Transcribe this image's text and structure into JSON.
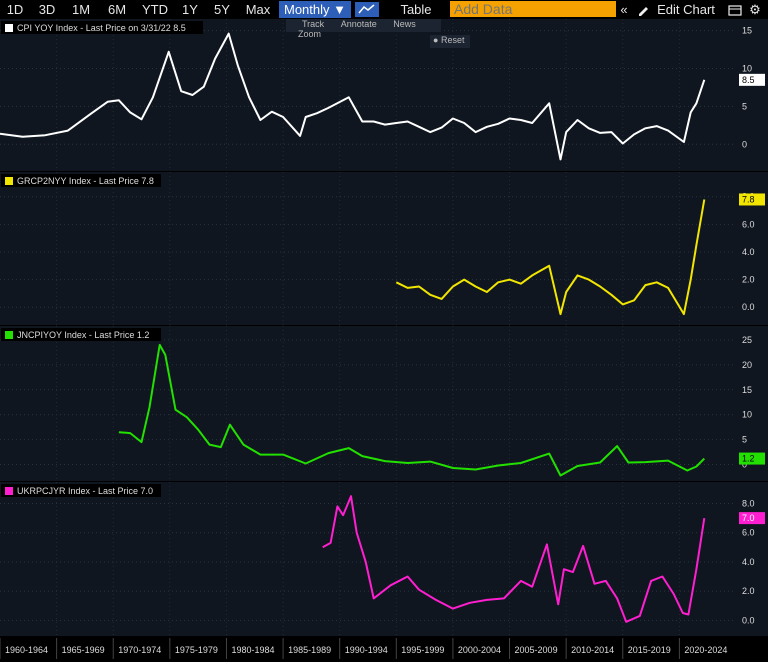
{
  "toolbar": {
    "periods": [
      "1D",
      "3D",
      "1M",
      "6M",
      "YTD",
      "1Y",
      "5Y",
      "Max"
    ],
    "frequency": "Monthly ▼",
    "table_label": "Table",
    "add_data_placeholder": "Add Data",
    "edit_chart_label": "Edit Chart",
    "tools": {
      "track": "Track",
      "annotate": "Annotate",
      "news": "News",
      "zoom": "Zoom",
      "reset": "Reset"
    }
  },
  "colors": {
    "background": "#000000",
    "panel_bg": "#0f1620",
    "cpi": "#ffffff",
    "grc": "#f2e600",
    "jn": "#22e000",
    "uk": "#ff1fd0",
    "active_button": "#2e5fb8",
    "add_data": "#f5a200"
  },
  "chart_data": [
    {
      "type": "line",
      "legend": "CPI YOY Index - Last Price on 3/31/22 8.5",
      "last_value_label": "8.5",
      "ylim": [
        -3,
        16
      ],
      "yticks": [
        "15",
        "10",
        "5",
        "0"
      ],
      "ytick_values": [
        15,
        10,
        5,
        0
      ],
      "x": [
        1960,
        1962,
        1964,
        1966,
        1968,
        1969.5,
        1970.5,
        1971.5,
        1972.5,
        1973.5,
        1974.9,
        1976,
        1977,
        1978,
        1979,
        1980.2,
        1981,
        1982,
        1983,
        1984,
        1985,
        1986.5,
        1987,
        1988,
        1989,
        1990.8,
        1992,
        1993,
        1994,
        1995,
        1996,
        1997,
        1998,
        1999,
        2000,
        2001,
        2002,
        2003,
        2004,
        2005,
        2006,
        2007,
        2008.5,
        2009.5,
        2010,
        2011,
        2012,
        2013,
        2014,
        2015,
        2016,
        2017,
        2018,
        2019,
        2020.4,
        2021,
        2021.5,
        2022.2
      ],
      "y": [
        1.4,
        1.0,
        1.2,
        1.8,
        4.0,
        5.6,
        5.8,
        4.2,
        3.3,
        6.2,
        12.2,
        7.0,
        6.5,
        7.6,
        11.3,
        14.6,
        10.4,
        6.2,
        3.2,
        4.3,
        3.6,
        1.1,
        3.6,
        4.1,
        4.8,
        6.2,
        3.0,
        3.0,
        2.6,
        2.8,
        3.0,
        2.3,
        1.6,
        2.2,
        3.4,
        2.8,
        1.6,
        2.3,
        2.7,
        3.4,
        3.2,
        2.8,
        5.4,
        -2.0,
        1.6,
        3.2,
        2.1,
        1.5,
        1.6,
        0.1,
        1.3,
        2.1,
        2.4,
        1.8,
        0.3,
        4.2,
        5.4,
        8.5
      ]
    },
    {
      "type": "line",
      "legend": "GRCP2NYY Index - Last Price 7.8",
      "last_value_label": "7.8",
      "ylim": [
        -1,
        9.5
      ],
      "yticks": [
        "8.0",
        "6.0",
        "4.0",
        "2.0",
        "0.0"
      ],
      "ytick_values": [
        8,
        6,
        4,
        2,
        0
      ],
      "x": [
        1995,
        1996,
        1997,
        1998,
        1999,
        2000,
        2001,
        2002,
        2003,
        2004,
        2005,
        2006,
        2007,
        2008.5,
        2009.5,
        2010,
        2011,
        2012,
        2013,
        2014,
        2015,
        2016,
        2017,
        2018,
        2019,
        2020.4,
        2021,
        2021.5,
        2022.2
      ],
      "y": [
        1.8,
        1.4,
        1.5,
        0.9,
        0.6,
        1.5,
        2.0,
        1.5,
        1.1,
        1.8,
        2.0,
        1.7,
        2.3,
        3.0,
        -0.5,
        1.1,
        2.3,
        2.0,
        1.5,
        0.9,
        0.2,
        0.5,
        1.6,
        1.8,
        1.4,
        -0.5,
        2.0,
        4.5,
        7.8
      ]
    },
    {
      "type": "line",
      "legend": "JNCPIYOY Index - Last Price 1.2",
      "last_value_label": "1.2",
      "ylim": [
        -2.5,
        27
      ],
      "yticks": [
        "25",
        "20",
        "15",
        "10",
        "5",
        "0"
      ],
      "ytick_values": [
        25,
        20,
        15,
        10,
        5,
        0
      ],
      "x": [
        1970.5,
        1971.5,
        1972.5,
        1973.2,
        1974.1,
        1974.6,
        1975.5,
        1976.5,
        1977.5,
        1978.5,
        1979.5,
        1980.3,
        1981.5,
        1983,
        1985,
        1987,
        1989,
        1990.8,
        1992,
        1994,
        1996,
        1998,
        2000,
        2002,
        2004,
        2006,
        2008.5,
        2009.5,
        2011,
        2013,
        2014.5,
        2015.5,
        2017,
        2019,
        2020.7,
        2021.5,
        2022.2
      ],
      "y": [
        6.5,
        6.3,
        4.5,
        11.5,
        24.0,
        22.0,
        11.0,
        9.5,
        7.0,
        4.0,
        3.5,
        8.0,
        4.0,
        2.0,
        2.0,
        0.2,
        2.3,
        3.3,
        1.7,
        0.7,
        0.3,
        0.6,
        -0.7,
        -1.0,
        -0.2,
        0.3,
        2.2,
        -2.2,
        -0.3,
        0.4,
        3.7,
        0.4,
        0.5,
        0.8,
        -1.2,
        -0.4,
        1.2
      ]
    },
    {
      "type": "line",
      "legend": "UKRPCJYR Index - Last Price 7.0",
      "last_value_label": "7.0",
      "ylim": [
        -0.8,
        9.2
      ],
      "yticks": [
        "8.0",
        "6.0",
        "4.0",
        "2.0",
        "0.0"
      ],
      "ytick_values": [
        8,
        6,
        4,
        2,
        0
      ],
      "x": [
        1988.5,
        1989.2,
        1989.8,
        1990.3,
        1991,
        1991.5,
        1992.3,
        1993,
        1994.5,
        1996,
        1997,
        1998.5,
        2000,
        2001.5,
        2003,
        2004.5,
        2006,
        2007,
        2008.3,
        2009.3,
        2009.8,
        2010.6,
        2011.5,
        2012.5,
        2013.5,
        2014.5,
        2015.3,
        2016.5,
        2017.5,
        2018.5,
        2019.5,
        2020.3,
        2020.8,
        2021.5,
        2022.2
      ],
      "y": [
        5.0,
        5.3,
        7.8,
        7.2,
        8.5,
        6.0,
        4.0,
        1.5,
        2.4,
        3.0,
        2.1,
        1.4,
        0.8,
        1.2,
        1.4,
        1.5,
        2.7,
        2.3,
        5.2,
        1.1,
        3.5,
        3.3,
        5.1,
        2.5,
        2.7,
        1.5,
        -0.1,
        0.3,
        2.7,
        3.0,
        1.8,
        0.5,
        0.4,
        3.5,
        7.0
      ]
    }
  ],
  "xaxis": {
    "labels": [
      "1960-1964",
      "1965-1969",
      "1970-1974",
      "1975-1979",
      "1980-1984",
      "1985-1989",
      "1990-1994",
      "1995-1999",
      "2000-2004",
      "2005-2009",
      "2010-2014",
      "2015-2019",
      "2020-2024"
    ],
    "range": [
      1960,
      2025
    ]
  }
}
